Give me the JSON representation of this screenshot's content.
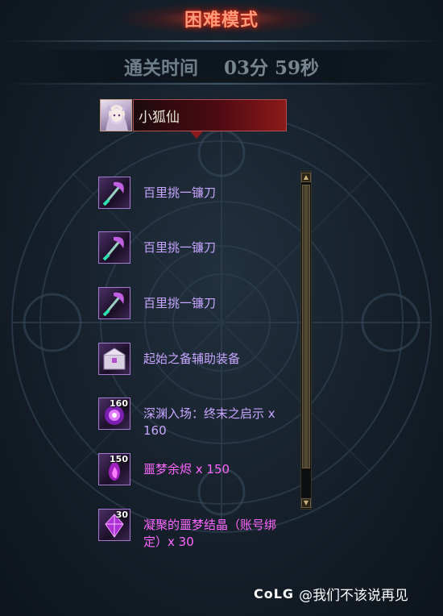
{
  "header": {
    "mode_title": "困难模式",
    "clear_time_label": "通关时间",
    "clear_time_value": "03分 59秒"
  },
  "player": {
    "name": "小狐仙"
  },
  "rewards": [
    {
      "name": "百里挑一镰刀",
      "count": "",
      "color": "purple",
      "icon": "scythe-icon"
    },
    {
      "name": "百里挑一镰刀",
      "count": "",
      "color": "purple",
      "icon": "scythe-icon"
    },
    {
      "name": "百里挑一镰刀",
      "count": "",
      "color": "purple",
      "icon": "scythe-icon"
    },
    {
      "name": "起始之备辅助装备",
      "count": "",
      "color": "purple",
      "icon": "gear-box-icon"
    },
    {
      "name": "深渊入场：终末之启示 x 160",
      "count": "160",
      "color": "purple",
      "icon": "abyss-orb-icon"
    },
    {
      "name": "噩梦余烬 x 150",
      "count": "150",
      "color": "pink",
      "icon": "ember-icon"
    },
    {
      "name": "凝聚的噩梦结晶（账号绑定）x 30",
      "count": "30",
      "color": "pink",
      "icon": "crystal-icon"
    }
  ],
  "watermark": {
    "logo": "CoLG",
    "text": "@我们不该说再见"
  },
  "colors": {
    "item_purple": "#c8a6ff",
    "item_pink": "#ff66ff",
    "title_glow": "#ff2a10"
  }
}
